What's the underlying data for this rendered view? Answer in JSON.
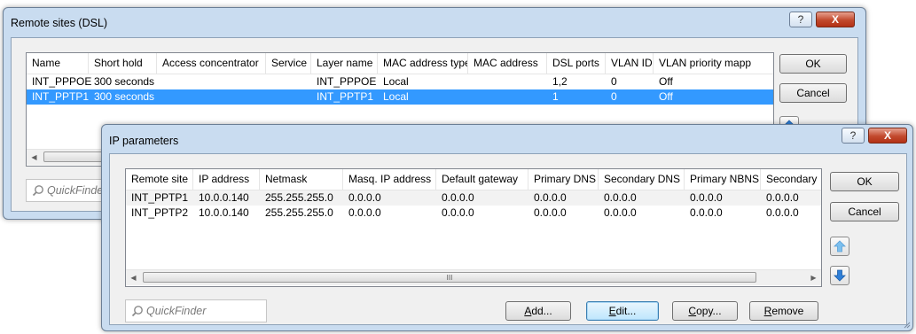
{
  "remote_sites": {
    "title": "Remote sites (DSL)",
    "help_glyph": "?",
    "close_glyph": "X",
    "columns": [
      "Name",
      "Short hold",
      "Access concentrator",
      "Service",
      "Layer name",
      "MAC address type",
      "MAC address",
      "DSL ports",
      "VLAN ID",
      "VLAN priority mapp"
    ],
    "rows": [
      [
        "INT_PPPOE",
        "300 seconds",
        "",
        "",
        "INT_PPPOE",
        "Local",
        "",
        "1,2",
        "0",
        "Off"
      ],
      [
        "INT_PPTP1",
        "300 seconds",
        "",
        "",
        "INT_PPTP1",
        "Local",
        "",
        "1",
        "0",
        "Off"
      ]
    ],
    "ok_label": "OK",
    "cancel_label": "Cancel",
    "quickfinder": "QuickFinder"
  },
  "ip_params": {
    "title": "IP parameters",
    "help_glyph": "?",
    "close_glyph": "X",
    "columns": [
      "Remote site",
      "IP address",
      "Netmask",
      "Masq. IP address",
      "Default gateway",
      "Primary DNS",
      "Secondary DNS",
      "Primary NBNS",
      "Secondary"
    ],
    "rows": [
      [
        "INT_PPTP1",
        "10.0.0.140",
        "255.255.255.0",
        "0.0.0.0",
        "0.0.0.0",
        "0.0.0.0",
        "0.0.0.0",
        "0.0.0.0",
        "0.0.0.0"
      ],
      [
        "INT_PPTP2",
        "10.0.0.140",
        "255.255.255.0",
        "0.0.0.0",
        "0.0.0.0",
        "0.0.0.0",
        "0.0.0.0",
        "0.0.0.0",
        "0.0.0.0"
      ]
    ],
    "ok_label": "OK",
    "cancel_label": "Cancel",
    "quickfinder": "QuickFinder",
    "scroll_grip": "III",
    "add_prefix": "A",
    "add_rest": "dd...",
    "edit_prefix": "E",
    "edit_rest": "dit...",
    "copy_prefix": "C",
    "copy_rest": "opy...",
    "remove_prefix": "R",
    "remove_rest": "emove"
  },
  "colors": {
    "selection": "#3399ff",
    "frame": "#c9dcf0",
    "close_red": "#c2492d",
    "arrow_blue": "#2f7fd8"
  }
}
